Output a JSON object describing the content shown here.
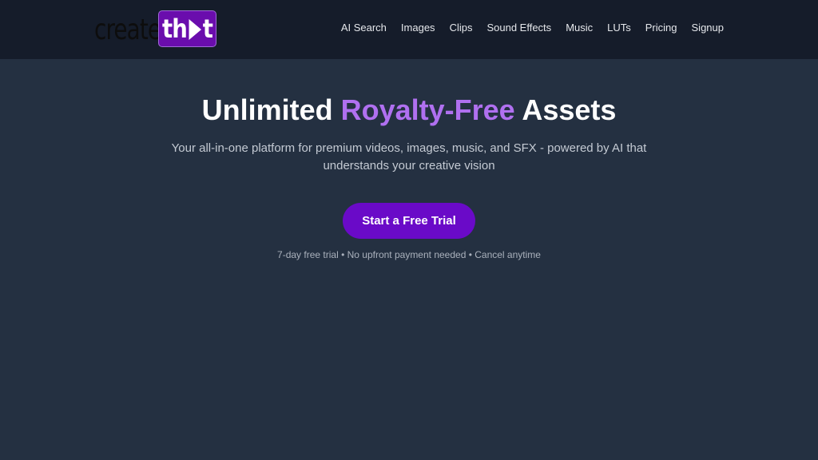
{
  "brand": {
    "logo_text_left": "create",
    "logo_text_box_a": "th",
    "logo_text_box_b": "t",
    "accent_color": "#6a0dad"
  },
  "nav": {
    "items": [
      {
        "label": "AI Search"
      },
      {
        "label": "Images"
      },
      {
        "label": "Clips"
      },
      {
        "label": "Sound Effects"
      },
      {
        "label": "Music"
      },
      {
        "label": "LUTs"
      },
      {
        "label": "Pricing"
      },
      {
        "label": "Signup"
      }
    ]
  },
  "hero": {
    "title_part1": "Unlimited ",
    "title_accent": "Royalty-Free",
    "title_part2": " Assets",
    "subtitle": "Your all-in-one platform for premium videos, images, music, and SFX - powered by AI that understands your creative vision",
    "cta_label": "Start a Free Trial",
    "fine_print": "7-day free trial • No upfront payment needed • Cancel anytime",
    "accent_color": "#b070f0",
    "button_color": "#6a0ac8"
  }
}
